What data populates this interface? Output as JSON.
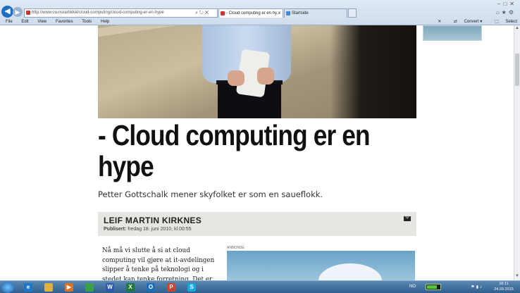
{
  "browser": {
    "address": "http://www.cw.no/artikkel/cloud-computing/cloud-computing-er-en-hype",
    "tabs": [
      {
        "label": "- Cloud computing er en hy..."
      },
      {
        "label": "Startside"
      }
    ],
    "menu": [
      "File",
      "Edit",
      "View",
      "Favorites",
      "Tools",
      "Help"
    ],
    "command_bar": {
      "convert": "Convert",
      "select": "Select"
    }
  },
  "article": {
    "headline": "- Cloud computing er en hype",
    "lede": "Petter Gottschalk mener skyfolket er som en saueflokk.",
    "author": "LEIF MARTIN KIRKNES",
    "published_label": "Publisert:",
    "published_date": "fredag 18. juni 2010, kl.00:55",
    "body": "Nå må vi slutte å si at cloud computing vil gjøre at it-avdelingen slipper å tenke på teknologi og i stedet kan tenke forretning. Det er bullshit! Hvis sjefene blir lurende",
    "photo_caption": "ANNONSE"
  },
  "taskbar": {
    "apps": [
      {
        "name": "ie",
        "letter": "e",
        "color": "#1e78c8"
      },
      {
        "name": "explorer",
        "letter": "",
        "color": "#e0b040"
      },
      {
        "name": "media",
        "letter": "▶",
        "color": "#e07020"
      },
      {
        "name": "chrome",
        "letter": "",
        "color": "#3aa14a"
      },
      {
        "name": "word",
        "letter": "W",
        "color": "#2b5aa8"
      },
      {
        "name": "excel",
        "letter": "X",
        "color": "#1f7a3a"
      },
      {
        "name": "outlook",
        "letter": "O",
        "color": "#1e6fb8"
      },
      {
        "name": "powerpoint",
        "letter": "P",
        "color": "#c8462a"
      },
      {
        "name": "skype",
        "letter": "S",
        "color": "#18a8e0"
      }
    ],
    "lang": "NO",
    "time": "16:11",
    "date": "24.09.2015"
  }
}
